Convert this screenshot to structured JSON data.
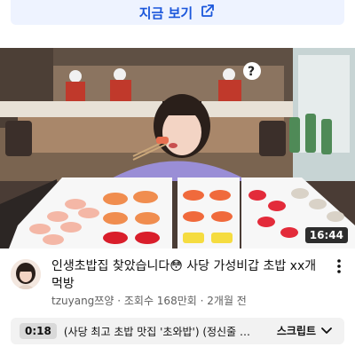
{
  "cta": {
    "label": "지금 보기",
    "icon": "open-external-icon",
    "color": "#1a56db"
  },
  "video": {
    "duration": "16:44",
    "thumbnail_text": "?",
    "title": "인생초밥집 찾았습니다😳 사당 가성비갑 초밥 xx개 먹방",
    "channel": "tzuyang쯔양",
    "views": "조회수 168만회",
    "age": "2개월 전",
    "separator": "·"
  },
  "chapter": {
    "time": "0:18",
    "title": "(사당 최고 초밥 맛집 '초와밥') (정신줄 놓…",
    "script_label": "스크립트",
    "chevron_icon": "chevron-down-icon"
  },
  "more_icon": "more-vertical-icon"
}
